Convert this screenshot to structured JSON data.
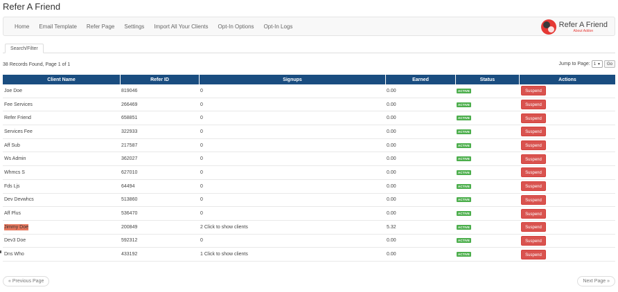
{
  "page": {
    "title": "Refer A Friend"
  },
  "nav": {
    "items": [
      "Home",
      "Email Template",
      "Refer Page",
      "Settings",
      "Import All Your Clients",
      "Opt-In Options",
      "Opt-In Logs"
    ],
    "brand": {
      "name": "Refer A Friend",
      "sub": "About Addon"
    }
  },
  "tabs": {
    "search_filter": "Search/Filter"
  },
  "summary": {
    "records": "38 Records Found, Page 1 of 1",
    "jump_label": "Jump to Page:",
    "jump_value": "1",
    "go_label": "Go"
  },
  "table": {
    "headers": [
      "Client Name",
      "Refer ID",
      "Signups",
      "Earned",
      "Status",
      "Actions"
    ],
    "rows": [
      {
        "name": "Joe Doe",
        "refer_id": "819046",
        "signups": "0",
        "earned": "0.00",
        "status": "ACTIVE",
        "action": "Suspend"
      },
      {
        "name": "Fee Services",
        "refer_id": "266469",
        "signups": "0",
        "earned": "0.00",
        "status": "ACTIVE",
        "action": "Suspend"
      },
      {
        "name": "Refer Friend",
        "refer_id": "658851",
        "signups": "0",
        "earned": "0.00",
        "status": "ACTIVE",
        "action": "Suspend"
      },
      {
        "name": "Services Fee",
        "refer_id": "322933",
        "signups": "0",
        "earned": "0.00",
        "status": "ACTIVE",
        "action": "Suspend"
      },
      {
        "name": "Aff Sub",
        "refer_id": "217587",
        "signups": "0",
        "earned": "0.00",
        "status": "ACTIVE",
        "action": "Suspend"
      },
      {
        "name": "Ws Admin",
        "refer_id": "362027",
        "signups": "0",
        "earned": "0.00",
        "status": "ACTIVE",
        "action": "Suspend"
      },
      {
        "name": "Whmcs S",
        "refer_id": "627010",
        "signups": "0",
        "earned": "0.00",
        "status": "ACTIVE",
        "action": "Suspend"
      },
      {
        "name": "Fds Ljs",
        "refer_id": "64494",
        "signups": "0",
        "earned": "0.00",
        "status": "ACTIVE",
        "action": "Suspend"
      },
      {
        "name": "Dev Devwhcs",
        "refer_id": "513860",
        "signups": "0",
        "earned": "0.00",
        "status": "ACTIVE",
        "action": "Suspend"
      },
      {
        "name": "Aff Plus",
        "refer_id": "536470",
        "signups": "0",
        "earned": "0.00",
        "status": "ACTIVE",
        "action": "Suspend"
      },
      {
        "name": "Jimmy Doe",
        "refer_id": "200849",
        "signups": "2 Click to show clients",
        "earned": "5.32",
        "status": "ACTIVE",
        "action": "Suspend",
        "highlight": true
      },
      {
        "name": "Dev3 Doe",
        "refer_id": "592312",
        "signups": "0",
        "earned": "0.00",
        "status": "ACTIVE",
        "action": "Suspend"
      },
      {
        "name": "Dns Who",
        "refer_id": "433192",
        "signups": "1 Click to show clients",
        "earned": "0.00",
        "status": "ACTIVE",
        "action": "Suspend"
      }
    ]
  },
  "pager": {
    "prev": "« Previous Page",
    "next": "Next Page »"
  },
  "colors": {
    "header_bg": "#1a4d80",
    "active_badge": "#4cae4c",
    "suspend_btn": "#d9534f",
    "highlight": "#e8785e",
    "brand_red": "#e53935"
  }
}
